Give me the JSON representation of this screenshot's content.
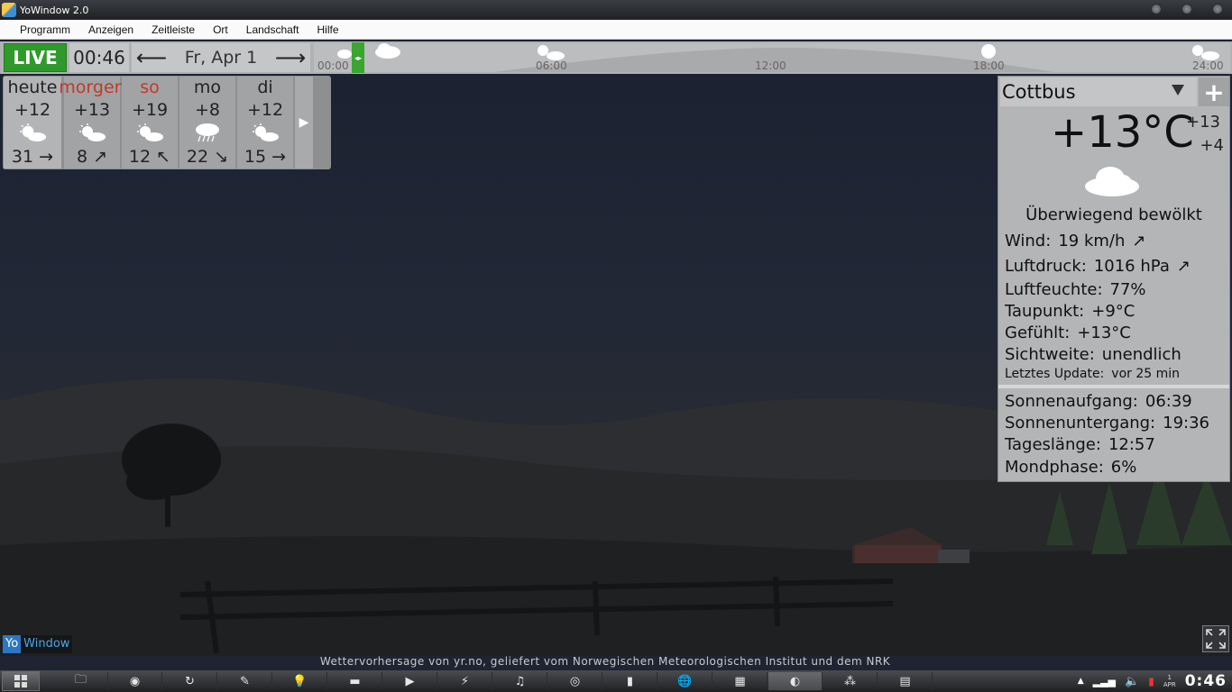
{
  "window": {
    "title": "YoWindow 2.0"
  },
  "menu": {
    "items": [
      "Programm",
      "Anzeigen",
      "Zeitleiste",
      "Ort",
      "Landschaft",
      "Hilfe"
    ]
  },
  "timeline": {
    "live_label": "LIVE",
    "time": "00:46",
    "date": "Fr, Apr 1",
    "prev_arrow": "⟵",
    "next_arrow": "⟶",
    "labels": [
      "00:00",
      "06:00",
      "12:00",
      "18:00",
      "24:00"
    ]
  },
  "forecast": {
    "days": [
      {
        "name": "heute",
        "temp": "+12",
        "icon": "sun-cloud-icon",
        "wind": "31 →",
        "highlight": false
      },
      {
        "name": "morgen",
        "temp": "+13",
        "icon": "sun-cloud-icon",
        "wind": "8 ↗",
        "highlight": true
      },
      {
        "name": "so",
        "temp": "+19",
        "icon": "sun-cloud-icon",
        "wind": "12 ↖",
        "highlight": true
      },
      {
        "name": "mo",
        "temp": "+8",
        "icon": "rain-cloud-icon",
        "wind": "22 ↘",
        "highlight": false
      },
      {
        "name": "di",
        "temp": "+12",
        "icon": "sun-cloud-icon",
        "wind": "15 →",
        "highlight": false
      }
    ],
    "next_arrow": "▶"
  },
  "location": {
    "name": "Cottbus",
    "add_label": "+",
    "current_temp": "+13°C",
    "high": "+13",
    "low": "+4",
    "condition_icon": "cloud-icon",
    "condition": "Überwiegend bewölkt",
    "wind": {
      "label": "Wind:",
      "value": "19 km/h",
      "arrow": "↗"
    },
    "pressure": {
      "label": "Luftdruck:",
      "value": "1016 hPa",
      "arrow": "↗"
    },
    "humidity": {
      "label": "Luftfeuchte:",
      "value": "77%"
    },
    "dewpoint": {
      "label": "Taupunkt:",
      "value": "+9°C"
    },
    "feels": {
      "label": "Gefühlt:",
      "value": "+13°C"
    },
    "visibility": {
      "label": "Sichtweite:",
      "value": "unendlich"
    },
    "update": {
      "label": "Letztes Update:",
      "value": "vor 25 min"
    },
    "sunrise": {
      "label": "Sonnenaufgang:",
      "value": "06:39"
    },
    "sunset": {
      "label": "Sonnenuntergang:",
      "value": "19:36"
    },
    "daylength": {
      "label": "Tageslänge:",
      "value": "12:57"
    },
    "moon": {
      "label": "Mondphase:",
      "value": "6%"
    }
  },
  "footer": {
    "credit": "Wettervorhersage von yr.no, geliefert vom Norwegischen Meteorologischen Institut und dem NRK",
    "logo_a": "Yo",
    "logo_b": "Window"
  },
  "taskbar": {
    "clock": "0:46",
    "date_small": "1\nAPR",
    "items": [
      "🗀",
      "◉",
      "↻",
      "✎",
      "💡",
      "▬",
      "▶",
      "⚡",
      "♫",
      "◎",
      "▮",
      "🌐",
      "▦",
      "◐",
      "⁂",
      "▤"
    ]
  },
  "colors": {
    "live_green": "#2f9a2b",
    "highlight_red": "#c0392b"
  }
}
